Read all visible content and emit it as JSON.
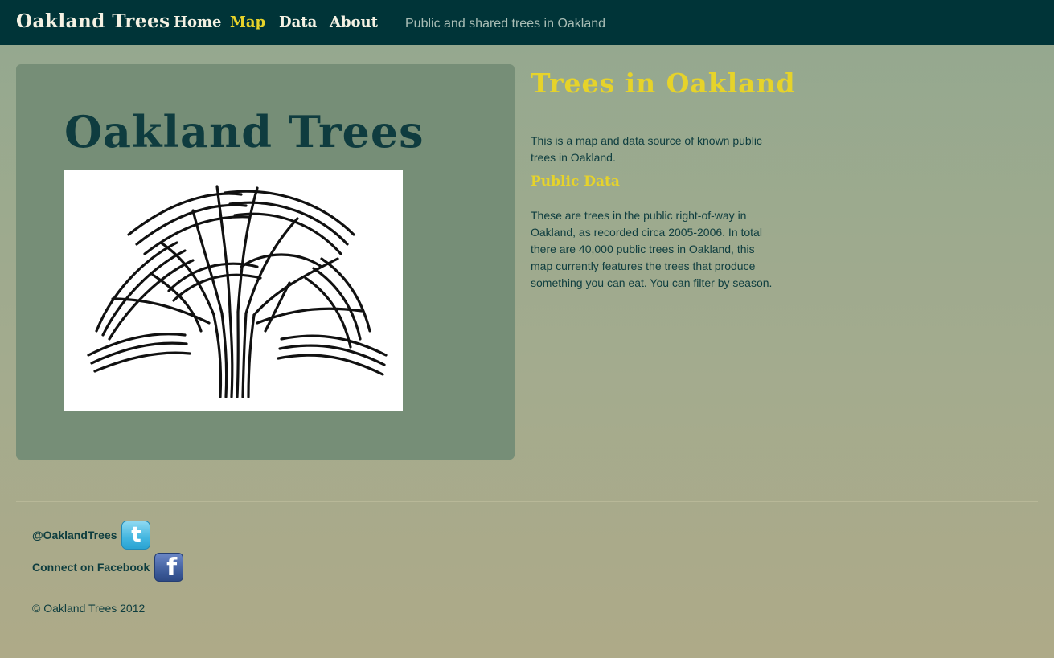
{
  "navbar": {
    "brand": "Oakland Trees",
    "items": [
      {
        "label": "Home",
        "active": false
      },
      {
        "label": "Map",
        "active": true
      },
      {
        "label": "Data",
        "active": false
      },
      {
        "label": "About",
        "active": false
      }
    ],
    "tagline": "Public and shared trees in Oakland"
  },
  "hero": {
    "title": "Oakland Trees",
    "image_icon": "oak-tree-logo"
  },
  "sidebar": {
    "title": "Trees in Oakland",
    "intro": "This is a map and data source of known public trees in Oakland.",
    "public_data_title": "Public Data",
    "public_data_text": "These are trees in the public right-of-way in Oakland, as recorded circa 2005-2006. In total there are 40,000 public trees in Oakland, this map currently features the trees that produce something you can eat. You can filter by season."
  },
  "footer": {
    "twitter_label": "@OaklandTrees",
    "twitter_icon": "twitter-icon",
    "facebook_label": "Connect on Facebook",
    "facebook_icon": "facebook-icon",
    "copyright": "© Oakland Trees 2012"
  },
  "colors": {
    "navbar_bg": "#003438",
    "accent": "#e6d32a",
    "hero_bg": "#768e77",
    "text": "#0e3d3f"
  }
}
